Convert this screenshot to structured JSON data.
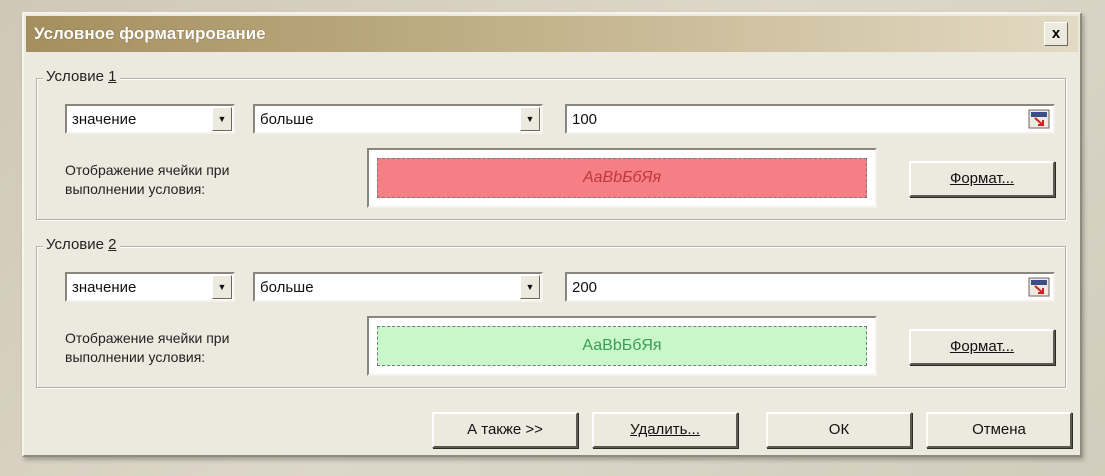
{
  "dialog": {
    "title": "Условное форматирование",
    "close_label": "x"
  },
  "conditions": [
    {
      "legend_prefix": "Условие ",
      "legend_number": "1",
      "type_value": "значение",
      "operator_value": "больше",
      "input_value": "100",
      "preview_label_line1": "Отображение ячейки при",
      "preview_label_line2": "выполнении условия:",
      "preview_sample": "АаВbБбЯя",
      "preview_bg": "#f67f86",
      "preview_text_color": "#c0383e",
      "format_button_label": "Формат..."
    },
    {
      "legend_prefix": "Условие ",
      "legend_number": "2",
      "type_value": "значение",
      "operator_value": "больше",
      "input_value": "200",
      "preview_label_line1": "Отображение ячейки при",
      "preview_label_line2": "выполнении условия:",
      "preview_sample": "АаВbБбЯя",
      "preview_bg": "#c8f8ca",
      "preview_text_color": "#3c9b54",
      "format_button_label": "Формат..."
    }
  ],
  "buttons": {
    "also_label": "А также >>",
    "delete_label": "Удалить...",
    "ok_label": "ОК",
    "cancel_label": "Отмена"
  },
  "icons": {
    "collapse": "collapse-dialog-icon",
    "dropdown": "chevron-down-icon",
    "close": "close-icon"
  }
}
